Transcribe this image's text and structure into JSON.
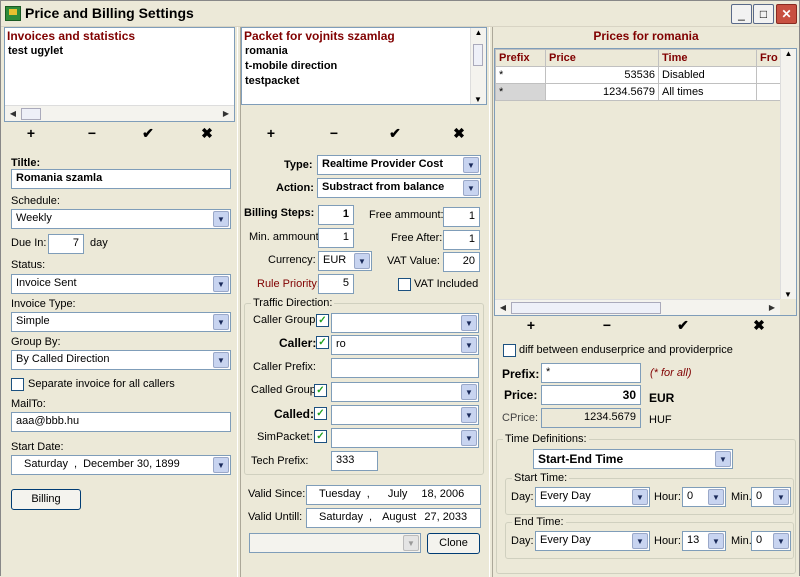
{
  "window": {
    "title": "Price and Billing Settings"
  },
  "invoices": {
    "header": "Invoices and statistics",
    "items": [
      "test ugylet"
    ]
  },
  "packet": {
    "header": "Packet for vojnits szamlag",
    "items": [
      "romania",
      "t-mobile direction",
      "testpacket"
    ]
  },
  "prices": {
    "header": "Prices for romania",
    "columns": [
      "Prefix",
      "Price",
      "Time",
      "Fro"
    ],
    "rows": [
      {
        "prefix": "*",
        "price": "53536",
        "time": "Disabled"
      },
      {
        "prefix": "*",
        "price": "1234.5679",
        "time": "All times"
      }
    ]
  },
  "toolbar": {
    "add": "+",
    "remove": "−",
    "ok": "✔",
    "cancel": "✖"
  },
  "left": {
    "title_label": "Tiltle:",
    "title_value": "Romania szamla",
    "schedule_label": "Schedule:",
    "schedule_value": "Weekly",
    "due_label": "Due In:",
    "due_value": "7",
    "due_unit": "day",
    "status_label": "Status:",
    "status_value": "Invoice Sent",
    "type_label": "Invoice Type:",
    "type_value": "Simple",
    "group_label": "Group By:",
    "group_value": "By Called Direction",
    "separate_label": "Separate invoice for all callers",
    "mailto_label": "MailTo:",
    "mailto_value": "aaa@bbb.hu",
    "start_label": "Start Date:",
    "start_day": "Saturday",
    "start_date": "December 30, 1899",
    "billing_button": "Billing"
  },
  "mid": {
    "type_label": "Type:",
    "type_value": "Realtime Provider Cost",
    "action_label": "Action:",
    "action_value": "Substract from balance",
    "steps_label": "Billing Steps:",
    "steps_value": "1",
    "free_amount_label": "Free ammount:",
    "free_amount_value": "1",
    "min_amount_label": "Min. ammount:",
    "min_amount_value": "1",
    "free_after_label": "Free After:",
    "free_after_value": "1",
    "currency_label": "Currency:",
    "currency_value": "EUR",
    "vat_label": "VAT Value:",
    "vat_value": "20",
    "priority_label": "Rule Priority:",
    "priority_value": "5",
    "vat_included_label": "VAT Included",
    "traffic_label": "Traffic Direction:",
    "caller_group_label": "Caller Group:",
    "caller_label": "Caller:",
    "caller_value": "ro",
    "caller_prefix_label": "Caller Prefix:",
    "called_group_label": "Called Group:",
    "called_label": "Called:",
    "simpacket_label": "SimPacket:",
    "tech_prefix_label": "Tech Prefix:",
    "tech_prefix_value": "333",
    "valid_since_label": "Valid Since:",
    "valid_since_day": "Tuesday",
    "valid_since_month": "July",
    "valid_since_date": "18, 2006",
    "valid_until_label": "Valid Untill:",
    "valid_until_day": "Saturday",
    "valid_until_month": "August",
    "valid_until_date": "27, 2033",
    "clone_button": "Clone"
  },
  "right": {
    "diff_label": "diff between enduserprice and providerprice",
    "prefix_label": "Prefix:",
    "prefix_value": "*",
    "prefix_hint": "(* for all)",
    "price_label": "Price:",
    "price_value": "30",
    "price_currency": "EUR",
    "cprice_label": "CPrice:",
    "cprice_value": "1234.5679",
    "cprice_currency": "HUF",
    "time_def_label": "Time Definitions:",
    "time_def_value": "Start-End Time",
    "start_time_label": "Start Time:",
    "end_time_label": "End Time:",
    "day_label": "Day:",
    "day_value": "Every Day",
    "hour_label": "Hour:",
    "min_label": "Min.:",
    "start_hour": "0",
    "start_min": "0",
    "end_hour": "13",
    "end_min": "0"
  }
}
